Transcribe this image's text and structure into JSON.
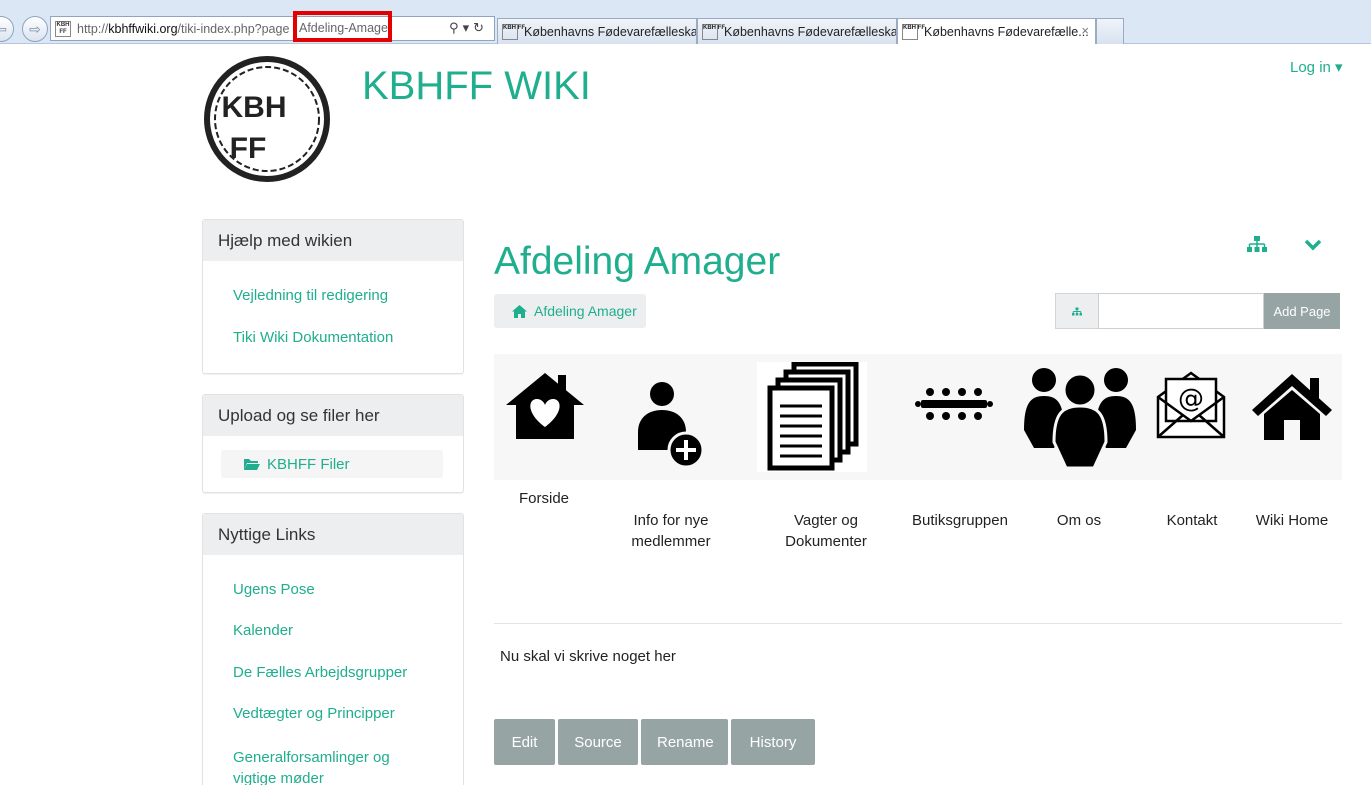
{
  "browser": {
    "url_prefix": "http://",
    "url_host": "kbhffwiki.org",
    "url_path": "/tiki-index.php?page",
    "url_highlight": "Afdeling-Amage",
    "favicon_text": "KBH FF",
    "tabs": [
      {
        "title": "Københavns Fødevarefælleska...",
        "active": false
      },
      {
        "title": "Københavns Fødevarefælleska...",
        "active": false
      },
      {
        "title": "Københavns Fødevarefælle...",
        "active": true,
        "close": "×"
      }
    ]
  },
  "site": {
    "logo_text_1": "KBH",
    "logo_text_2": "FF",
    "title": "KBHFF WIKI",
    "login_label": "Log in ▾"
  },
  "sidebar": {
    "help": {
      "title": "Hjælp med wikien",
      "links": [
        "Vejledning til redigering",
        "Tiki Wiki Dokumentation"
      ]
    },
    "upload": {
      "title": "Upload og se filer her",
      "link": "KBHFF Filer"
    },
    "useful": {
      "title": "Nyttige Links",
      "links": [
        "Ugens Pose",
        "Kalender",
        "De Fælles Arbejdsgrupper",
        "Vedtægter og Principper",
        "Generalforsamlinger og vigtige møder"
      ]
    }
  },
  "main": {
    "title": "Afdeling Amager",
    "breadcrumb": "Afdeling Amager",
    "add_page_placeholder": "",
    "add_page_button": "Add Page",
    "nav_icons": [
      {
        "label": "Forside",
        "icon": "heart-house-icon"
      },
      {
        "label": "Info for nye medlemmer",
        "icon": "add-user-icon"
      },
      {
        "label": "Vagter og Dokumenter",
        "icon": "documents-icon"
      },
      {
        "label": "Butiksgruppen",
        "icon": "meeting-table-icon"
      },
      {
        "label": "Om os",
        "icon": "group-icon"
      },
      {
        "label": "Kontakt",
        "icon": "email-icon"
      },
      {
        "label": "Wiki Home",
        "icon": "home-icon"
      }
    ],
    "body_text": "Nu skal vi skrive noget her",
    "actions": [
      "Edit",
      "Source",
      "Rename",
      "History"
    ]
  },
  "colors": {
    "accent": "#1fae8e",
    "button_gray": "#96a5a3",
    "panel_head": "#eceeef"
  }
}
